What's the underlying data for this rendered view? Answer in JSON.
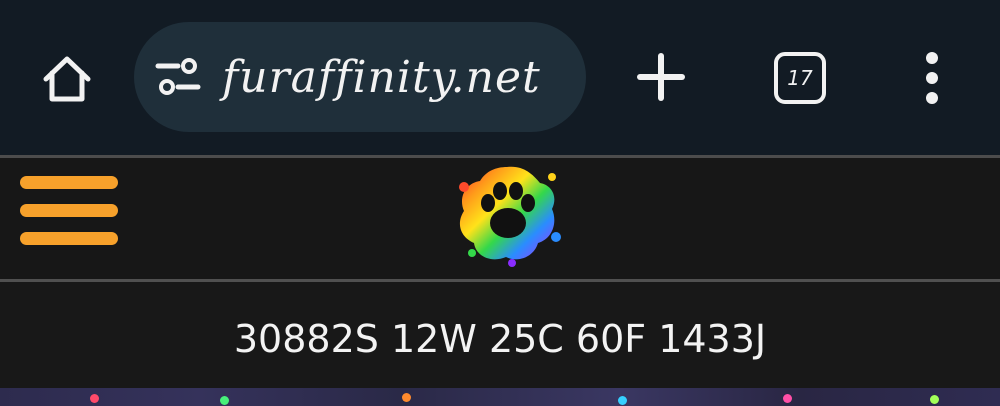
{
  "browser": {
    "url": "furaffinity.net",
    "tab_count": "17",
    "icons": {
      "home": "home-icon",
      "site_settings": "tune-icon",
      "new_tab": "plus-icon",
      "tabs": "tab-switcher-icon",
      "menu": "more-vertical-icon"
    }
  },
  "site": {
    "menu_icon": "hamburger-menu-icon",
    "logo": "rainbow-paw-splash-logo",
    "stats": "30882S 12W 25C 60F 1433J"
  },
  "colors": {
    "browser_bg": "#121b24",
    "url_pill": "#1f2f3a",
    "header_bg": "#171717",
    "accent": "#f7a12b"
  }
}
